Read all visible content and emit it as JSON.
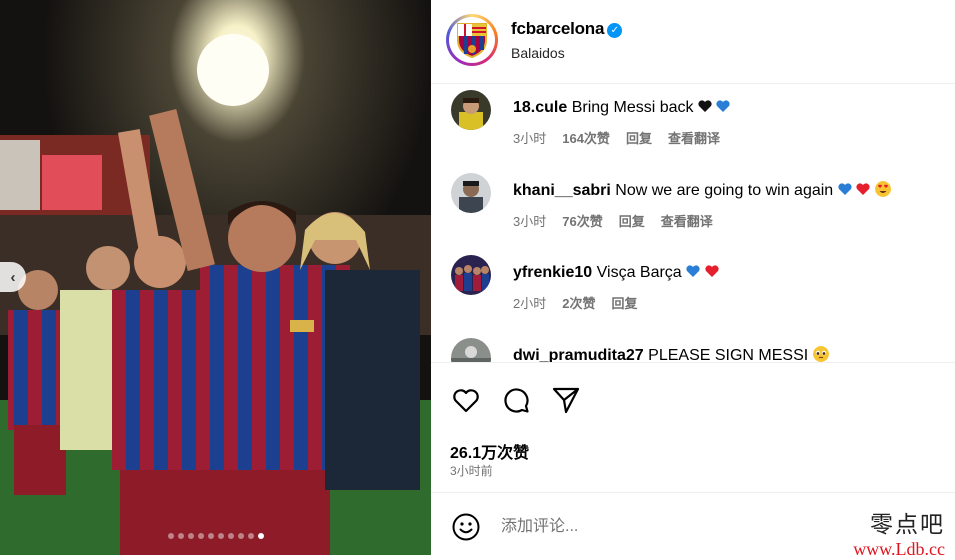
{
  "post": {
    "username": "fcbarcelona",
    "location": "Balaidos",
    "verified": true,
    "image_alt": "Barcelona players celebrating in blaugrana shirts under stadium lights",
    "carousel": {
      "dots": 10,
      "active_index": 9
    },
    "likes": "26.1万次赞",
    "posted_time": "3小时前"
  },
  "comments": [
    {
      "user": "18.cule",
      "text": "Bring Messi back",
      "emoji": [
        "black-heart",
        "blue-heart"
      ],
      "time": "3小时",
      "likes": "164次赞",
      "reply": "回复",
      "translate": "查看翻译"
    },
    {
      "user": "khani__sabri",
      "text": "Now we are going to win again",
      "emoji": [
        "blue-heart",
        "red-heart",
        "heart-eyes"
      ],
      "time": "3小时",
      "likes": "76次赞",
      "reply": "回复",
      "translate": "查看翻译"
    },
    {
      "user": "yfrenkie10",
      "text": "Visça Barça",
      "emoji": [
        "blue-heart",
        "red-heart"
      ],
      "time": "2小时",
      "likes": "2次赞",
      "reply": "回复"
    },
    {
      "user": "dwi_pramudita27",
      "text": "PLEASE SIGN MESSI",
      "emoji": [
        "pleading-face"
      ]
    }
  ],
  "comment_box": {
    "placeholder": "添加评论..."
  },
  "watermark": {
    "chinese": "零点吧",
    "url": "www.Ldb.cc"
  },
  "colors": {
    "verified_blue": "#0095f6",
    "barca_blue": "#1e4fa3",
    "barca_red": "#b0203a",
    "meta_gray": "#737373"
  }
}
